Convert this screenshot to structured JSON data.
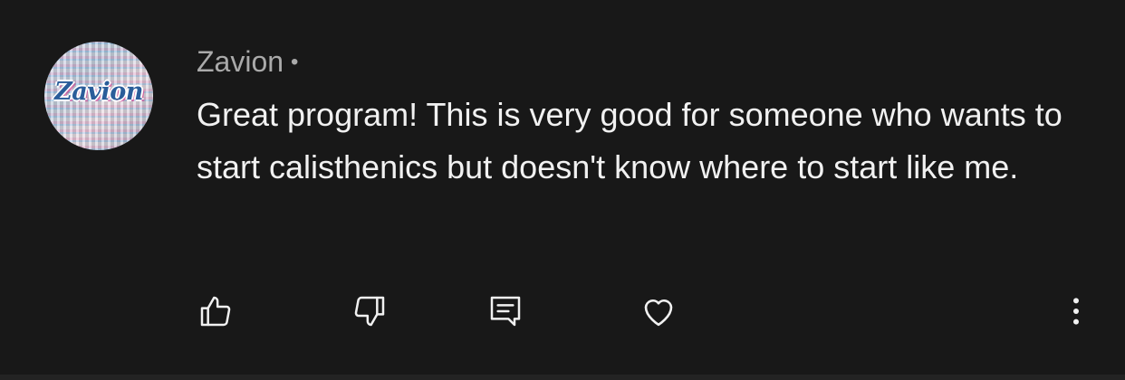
{
  "comment": {
    "avatar_text": "Zavion",
    "author": "Zavion",
    "separator": "•",
    "text": "Great program! This is very good for someone who wants to start calisthenics but doesn't know where to start like me."
  },
  "actions": {
    "like_icon": "thumbs-up-icon",
    "dislike_icon": "thumbs-down-icon",
    "reply_icon": "comment-icon",
    "heart_icon": "heart-icon",
    "more_icon": "more-vertical-icon"
  },
  "colors": {
    "background": "#181818",
    "author": "#aaaaaa",
    "text": "#f1f1f1"
  }
}
